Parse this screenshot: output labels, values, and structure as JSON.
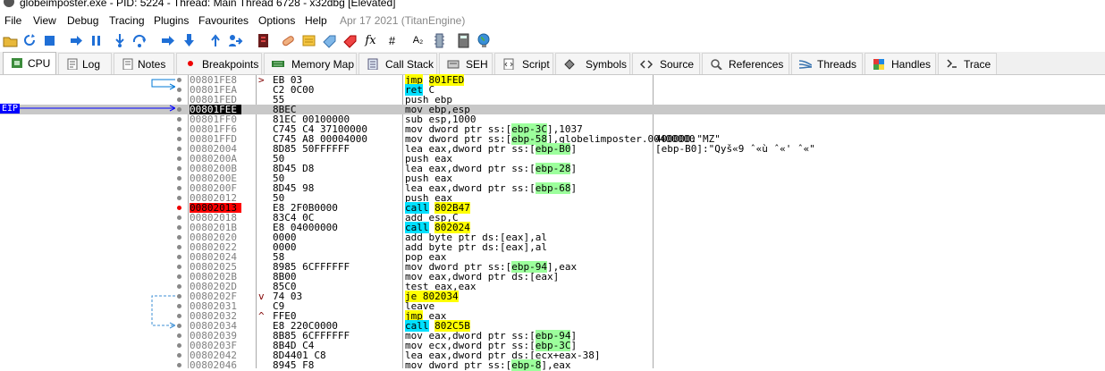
{
  "window": {
    "title": "globeimposter.exe - PID: 5224 - Thread: Main Thread 6728 - x32dbg [Elevated]"
  },
  "menu": [
    "File",
    "View",
    "Debug",
    "Tracing",
    "Plugins",
    "Favourites",
    "Options",
    "Help"
  ],
  "menu_date": "Apr 17 2021 (TitanEngine)",
  "toolbar_icons": [
    "open-icon",
    "restart-icon",
    "stop-icon",
    "run-icon",
    "pause-icon",
    "step-into-icon",
    "step-over-icon",
    "trace-into-icon",
    "trace-over-icon",
    "execute-till-return-icon",
    "run-to-user-code-icon",
    "scylla-icon",
    "patch-icon",
    "comment-icon",
    "label-icon",
    "bookmark-icon",
    "function-icon",
    "hash-icon",
    "font-icon",
    "memory-icon",
    "calculator-icon",
    "globe-icon"
  ],
  "toolbar_glyphs": {
    "fx": "fx",
    "hash": "#",
    "font": "A₂"
  },
  "tabs": [
    {
      "label": "CPU",
      "icon": "cpu-icon",
      "active": true
    },
    {
      "label": "Log",
      "icon": "log-icon"
    },
    {
      "label": "Notes",
      "icon": "notes-icon"
    },
    {
      "label": "Breakpoints",
      "icon": "breakpoint-icon"
    },
    {
      "label": "Memory Map",
      "icon": "memory-map-icon"
    },
    {
      "label": "Call Stack",
      "icon": "call-stack-icon"
    },
    {
      "label": "SEH",
      "icon": "seh-icon"
    },
    {
      "label": "Script",
      "icon": "script-icon"
    },
    {
      "label": "Symbols",
      "icon": "symbols-icon"
    },
    {
      "label": "Source",
      "icon": "source-icon"
    },
    {
      "label": "References",
      "icon": "references-icon"
    },
    {
      "label": "Threads",
      "icon": "threads-icon"
    },
    {
      "label": "Handles",
      "icon": "handles-icon"
    },
    {
      "label": "Trace",
      "icon": "trace-icon"
    }
  ],
  "eip_label": "EIP",
  "rows": [
    {
      "addr": "00801FE8",
      "mark": ">",
      "bytes": "EB 03",
      "instr": [
        {
          "t": "jmp",
          "c": "yl"
        },
        {
          "t": " "
        },
        {
          "t": "801FED",
          "c": "yl"
        }
      ]
    },
    {
      "addr": "00801FEA",
      "bytes": "C2 0C00",
      "instr": [
        {
          "t": "ret",
          "c": "cy"
        },
        {
          "t": " C"
        }
      ]
    },
    {
      "addr": "00801FED",
      "bytes": "55",
      "instr": [
        {
          "t": "push ebp"
        }
      ]
    },
    {
      "addr": "00801FEE",
      "bytes": "8BEC",
      "instr": [
        {
          "t": "mov ebp,esp"
        }
      ],
      "sel": true,
      "eip": true
    },
    {
      "addr": "00801FF0",
      "bytes": "81EC 00100000",
      "instr": [
        {
          "t": "sub esp,1000"
        }
      ]
    },
    {
      "addr": "00801FF6",
      "bytes": "C745 C4 37100000",
      "instr": [
        {
          "t": "mov dword ptr ss:["
        },
        {
          "t": "ebp-3C",
          "c": "gr"
        },
        {
          "t": "],1037"
        }
      ]
    },
    {
      "addr": "00801FFD",
      "bytes": "C745 A8 00004000",
      "instr": [
        {
          "t": "mov dword ptr ss:["
        },
        {
          "t": "ebp-58",
          "c": "gr"
        },
        {
          "t": "],globelimposter.00400000"
        }
      ],
      "cmt": "400000:\"MZ\""
    },
    {
      "addr": "00802004",
      "bytes": "8D85 50FFFFFF",
      "instr": [
        {
          "t": "lea eax,dword ptr ss:["
        },
        {
          "t": "ebp-B0",
          "c": "gr"
        },
        {
          "t": "]"
        }
      ],
      "cmt": "[ebp-B0]:\"Qyš«9 ˆ«ù ˆ«' ˆ«\""
    },
    {
      "addr": "0080200A",
      "bytes": "50",
      "instr": [
        {
          "t": "push eax"
        }
      ]
    },
    {
      "addr": "0080200B",
      "bytes": "8D45 D8",
      "instr": [
        {
          "t": "lea eax,dword ptr ss:["
        },
        {
          "t": "ebp-28",
          "c": "gr"
        },
        {
          "t": "]"
        }
      ]
    },
    {
      "addr": "0080200E",
      "bytes": "50",
      "instr": [
        {
          "t": "push eax"
        }
      ]
    },
    {
      "addr": "0080200F",
      "bytes": "8D45 98",
      "instr": [
        {
          "t": "lea eax,dword ptr ss:["
        },
        {
          "t": "ebp-68",
          "c": "gr"
        },
        {
          "t": "]"
        }
      ]
    },
    {
      "addr": "00802012",
      "bytes": "50",
      "instr": [
        {
          "t": "push eax"
        }
      ]
    },
    {
      "addr": "00802013",
      "bytes": "E8 2F0B0000",
      "instr": [
        {
          "t": "call",
          "c": "cy"
        },
        {
          "t": " "
        },
        {
          "t": "802B47",
          "c": "yl"
        }
      ],
      "bp": true
    },
    {
      "addr": "00802018",
      "bytes": "83C4 0C",
      "instr": [
        {
          "t": "add esp,C"
        }
      ]
    },
    {
      "addr": "0080201B",
      "bytes": "E8 04000000",
      "instr": [
        {
          "t": "call",
          "c": "cy"
        },
        {
          "t": " "
        },
        {
          "t": "802024",
          "c": "yl"
        }
      ]
    },
    {
      "addr": "00802020",
      "bytes": "0000",
      "instr": [
        {
          "t": "add byte ptr ds:[eax],al"
        }
      ]
    },
    {
      "addr": "00802022",
      "bytes": "0000",
      "instr": [
        {
          "t": "add byte ptr ds:[eax],al"
        }
      ]
    },
    {
      "addr": "00802024",
      "bytes": "58",
      "instr": [
        {
          "t": "pop eax"
        }
      ]
    },
    {
      "addr": "00802025",
      "bytes": "8985 6CFFFFFF",
      "instr": [
        {
          "t": "mov dword ptr ss:["
        },
        {
          "t": "ebp-94",
          "c": "gr"
        },
        {
          "t": "],eax"
        }
      ]
    },
    {
      "addr": "0080202B",
      "bytes": "8B00",
      "instr": [
        {
          "t": "mov eax,dword ptr ds:[eax]"
        }
      ]
    },
    {
      "addr": "0080202D",
      "bytes": "85C0",
      "instr": [
        {
          "t": "test eax,eax"
        }
      ]
    },
    {
      "addr": "0080202F",
      "mark": "v",
      "bytes": "74 03",
      "instr": [
        {
          "t": "je 802034",
          "c": "yl"
        }
      ]
    },
    {
      "addr": "00802031",
      "bytes": "C9",
      "instr": [
        {
          "t": "leave"
        }
      ]
    },
    {
      "addr": "00802032",
      "mark": "^",
      "bytes": "FFE0",
      "instr": [
        {
          "t": "jmp",
          "c": "yl"
        },
        {
          "t": " eax"
        }
      ]
    },
    {
      "addr": "00802034",
      "bytes": "E8 220C0000",
      "instr": [
        {
          "t": "call",
          "c": "cy"
        },
        {
          "t": " "
        },
        {
          "t": "802C5B",
          "c": "yl"
        }
      ]
    },
    {
      "addr": "00802039",
      "bytes": "8B85 6CFFFFFF",
      "instr": [
        {
          "t": "mov eax,dword ptr ss:["
        },
        {
          "t": "ebp-94",
          "c": "gr"
        },
        {
          "t": "]"
        }
      ]
    },
    {
      "addr": "0080203F",
      "bytes": "8B4D C4",
      "instr": [
        {
          "t": "mov ecx,dword ptr ss:["
        },
        {
          "t": "ebp-3C",
          "c": "gr"
        },
        {
          "t": "]"
        }
      ]
    },
    {
      "addr": "00802042",
      "bytes": "8D4401 C8",
      "instr": [
        {
          "t": "lea eax,dword ptr ds:[ecx+eax-38]"
        }
      ]
    },
    {
      "addr": "00802046",
      "bytes": "8945 F8",
      "instr": [
        {
          "t": "mov dword ptr ss:["
        },
        {
          "t": "ebp-8",
          "c": "gr"
        },
        {
          "t": "],eax"
        }
      ]
    }
  ]
}
